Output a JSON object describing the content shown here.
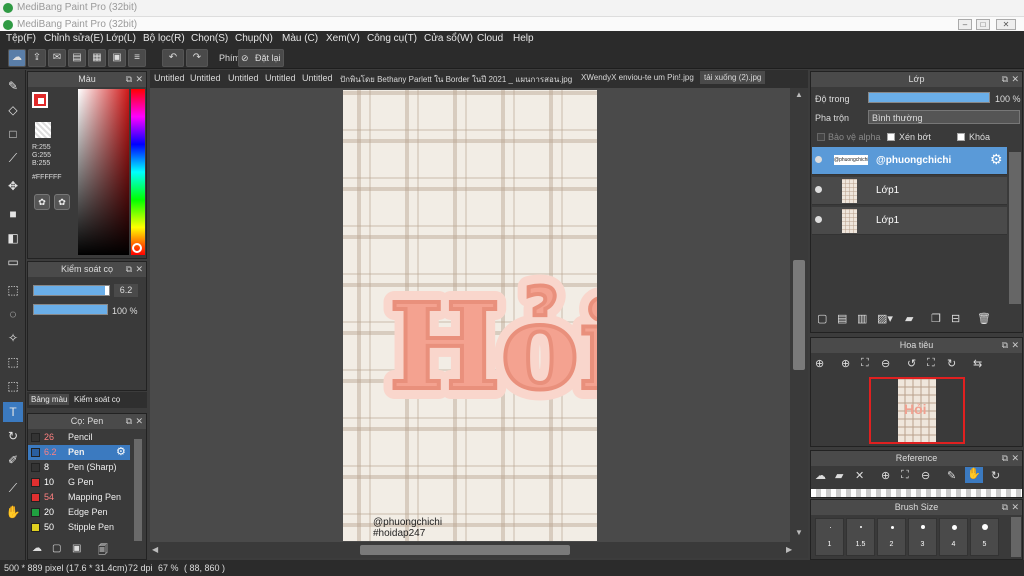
{
  "window": {
    "back_title": "MediBang Paint Pro (32bit)",
    "front_title": "MediBang Paint Pro (32bit)"
  },
  "menu": [
    "Tệp(F)",
    "Chỉnh sửa(E)",
    "Lớp(L)",
    "Bộ lọc(R)",
    "Chọn(S)",
    "Chụp(N)",
    "Màu (C)",
    "Xem(V)",
    "Công cụ(T)",
    "Cửa sổ(W)",
    "Cloud",
    "Help"
  ],
  "toolbar": {
    "snap_label": "Phím",
    "reset_label": "Đặt lại"
  },
  "color_panel": {
    "title": "Màu",
    "r": "R:255",
    "g": "G:255",
    "b": "B:255",
    "hex": "#FFFFFF",
    "foreground": "#e02a2a",
    "background": "#ffffff"
  },
  "brush_control": {
    "title": "Kiểm soát cọ",
    "size": "6.2",
    "opacity": "100 %",
    "size_level": 0.95,
    "opacity_level": 1.0
  },
  "left_tabs": {
    "palette": "Bảng màu",
    "brush_control": "Kiểm soát cọ"
  },
  "brush_panel": {
    "title": "Cọ: Pen",
    "brushes": [
      {
        "size": "26",
        "name": "Pencil",
        "color": "#333333",
        "size_color": "#ff8080"
      },
      {
        "size": "6.2",
        "name": "Pen",
        "color": "#2a5fa0",
        "size_color": "#ff8080",
        "selected": true
      },
      {
        "size": "8",
        "name": "Pen (Sharp)",
        "color": "#333333",
        "size_color": "#ffffff"
      },
      {
        "size": "10",
        "name": "G Pen",
        "color": "#e03030",
        "size_color": "#ffffff"
      },
      {
        "size": "54",
        "name": "Mapping Pen",
        "color": "#e03030",
        "size_color": "#ff8080"
      },
      {
        "size": "20",
        "name": "Edge Pen",
        "color": "#20a040",
        "size_color": "#ffffff"
      },
      {
        "size": "50",
        "name": "Stipple Pen",
        "color": "#e0d020",
        "size_color": "#ffffff"
      }
    ]
  },
  "tabs": [
    "Untitled",
    "Untitled",
    "Untitled",
    "Untitled",
    "Untitled",
    "ปักพินโดย Bethany Parlett ใน Border ในปี 2021 _ แผนการสอน.jpg",
    "XWendyX enviou-te um Pin!.jpg",
    "tải xuống (2).jpg"
  ],
  "canvas": {
    "artwork_text": "Hỏi",
    "watermark_line1": "@phuongchichi",
    "watermark_line2": "#hoidap247"
  },
  "layer_panel": {
    "title": "Lớp",
    "opacity_label": "Độ trong",
    "opacity_value": "100 %",
    "blend_label": "Pha trộn",
    "blend_value": "Bình thường",
    "protect_alpha": "Bảo vệ alpha",
    "clipping": "Xén bớt",
    "lock": "Khóa",
    "layers": [
      {
        "name": "@phuongchichi",
        "thumb": "@phuongchichi",
        "selected": true
      },
      {
        "name": "Lớp1",
        "thumb": "",
        "selected": false
      },
      {
        "name": "Lớp1",
        "thumb": "",
        "selected": false
      }
    ]
  },
  "navigator": {
    "title": "Hoa tiêu"
  },
  "reference": {
    "title": "Reference"
  },
  "brush_size": {
    "title": "Brush Size",
    "sizes": [
      "1",
      "1.5",
      "2",
      "3",
      "4",
      "5"
    ]
  },
  "status": {
    "dimensions": "500 * 889 pixel",
    "physical": "(17.6 * 31.4cm)",
    "dpi": "72 dpi",
    "zoom": "67 %",
    "coords": "( 88, 860 )"
  }
}
